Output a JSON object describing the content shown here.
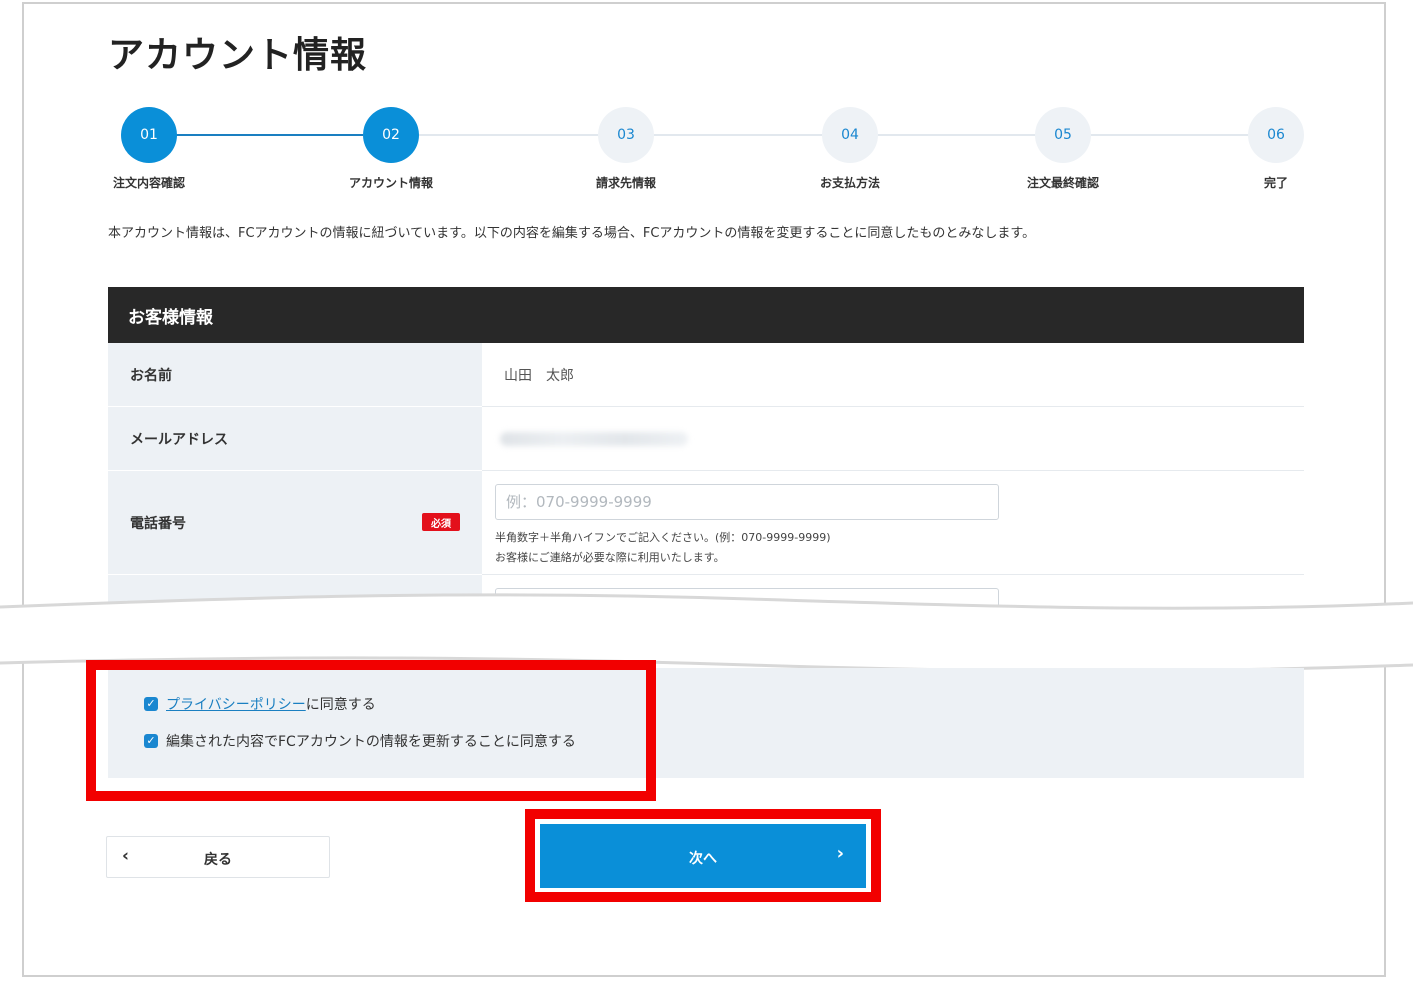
{
  "page": {
    "title": "アカウント情報"
  },
  "stepper": {
    "steps": [
      {
        "number": "01",
        "label": "注文内容確認"
      },
      {
        "number": "02",
        "label": "アカウント情報"
      },
      {
        "number": "03",
        "label": "請求先情報"
      },
      {
        "number": "04",
        "label": "お支払方法"
      },
      {
        "number": "05",
        "label": "注文最終確認"
      },
      {
        "number": "06",
        "label": "完了"
      }
    ],
    "current_step": 2
  },
  "notice": "本アカウント情報は、FCアカウントの情報に紐づいています。以下の内容を編集する場合、FCアカウントの情報を変更することに同意したものとみなします。",
  "customer_info": {
    "heading": "お客様情報",
    "name_label": "お名前",
    "name_value": "山田　太郎",
    "email_label": "メールアドレス",
    "phone_label": "電話番号",
    "required_badge": "必須",
    "phone_placeholder": "例：070-9999-9999",
    "phone_hint_1": "半角数字＋半角ハイフンでご記入ください。(例：070-9999-9999)",
    "phone_hint_2": "お客様にご連絡が必要な際に利用いたします。"
  },
  "agreements": {
    "privacy_link": "プライバシーポリシー",
    "privacy_suffix": "に同意する",
    "privacy_checked": true,
    "update_text": "編集された内容でFCアカウントの情報を更新することに同意する",
    "update_checked": true
  },
  "buttons": {
    "back": "戻る",
    "next": "次へ"
  },
  "colors": {
    "accent": "#0a8fd8",
    "highlight": "#f20000",
    "header_bg": "#282828",
    "required": "#e3101b"
  }
}
